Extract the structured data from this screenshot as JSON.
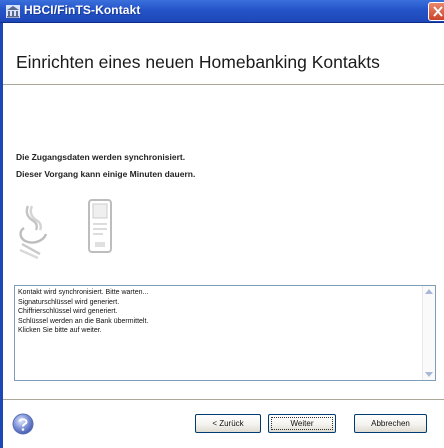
{
  "window": {
    "title": "HBCI/FinTS-Kontakt"
  },
  "heading": "Einrichten eines neuen Homebanking Kontakts",
  "info": {
    "line1": "Die Zugangsdaten werden synchronisiert.",
    "line2": "Dieser Vorgang kann einige Minuten dauern."
  },
  "log": {
    "lines": [
      "Kontakt wird synchronisiert. Bitte warten...",
      "Signaturschlüssel wird generiert.",
      "Chiffrierschlüssel wird generiert.",
      "Schlüssel werden an die Bank übermittelt.",
      "Klicken Sie bitte auf weiter."
    ]
  },
  "buttons": {
    "back": "< Zurück",
    "next": "Weiter",
    "cancel": "Abbrechen"
  },
  "icons": {
    "app": "bank-icon",
    "close": "close-icon",
    "left_animation": "key-with-lines-icon",
    "right_animation": "card-shape-icon",
    "help": "help-icon"
  },
  "colors": {
    "titlebar": "#2454c8",
    "close": "#c9452a",
    "button_border": "#003c74"
  }
}
